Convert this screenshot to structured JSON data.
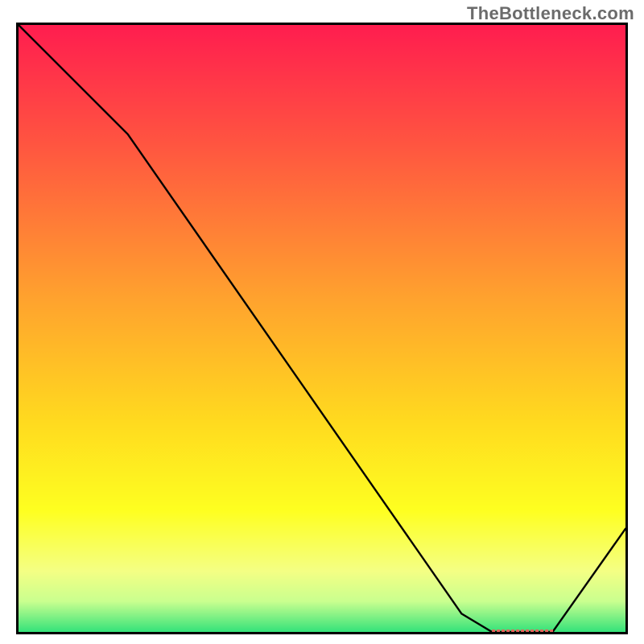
{
  "watermark": "TheBottleneck.com",
  "chart_data": {
    "type": "line",
    "title": "",
    "xlabel": "",
    "ylabel": "",
    "xlim": [
      0,
      100
    ],
    "ylim": [
      0,
      100
    ],
    "x": [
      0,
      18,
      73,
      78,
      88,
      100
    ],
    "values": [
      100,
      82,
      3,
      0,
      0,
      17
    ],
    "highlight_band": {
      "x_start": 78,
      "x_end": 88,
      "y": 0
    },
    "background_gradient_stops": [
      {
        "offset": 0,
        "color": "#ff1d4f"
      },
      {
        "offset": 20,
        "color": "#ff5640"
      },
      {
        "offset": 45,
        "color": "#ffa22e"
      },
      {
        "offset": 65,
        "color": "#ffd91f"
      },
      {
        "offset": 80,
        "color": "#feff20"
      },
      {
        "offset": 90,
        "color": "#f4ff84"
      },
      {
        "offset": 95,
        "color": "#c9ff8f"
      },
      {
        "offset": 100,
        "color": "#34e27a"
      }
    ],
    "grid": false
  }
}
